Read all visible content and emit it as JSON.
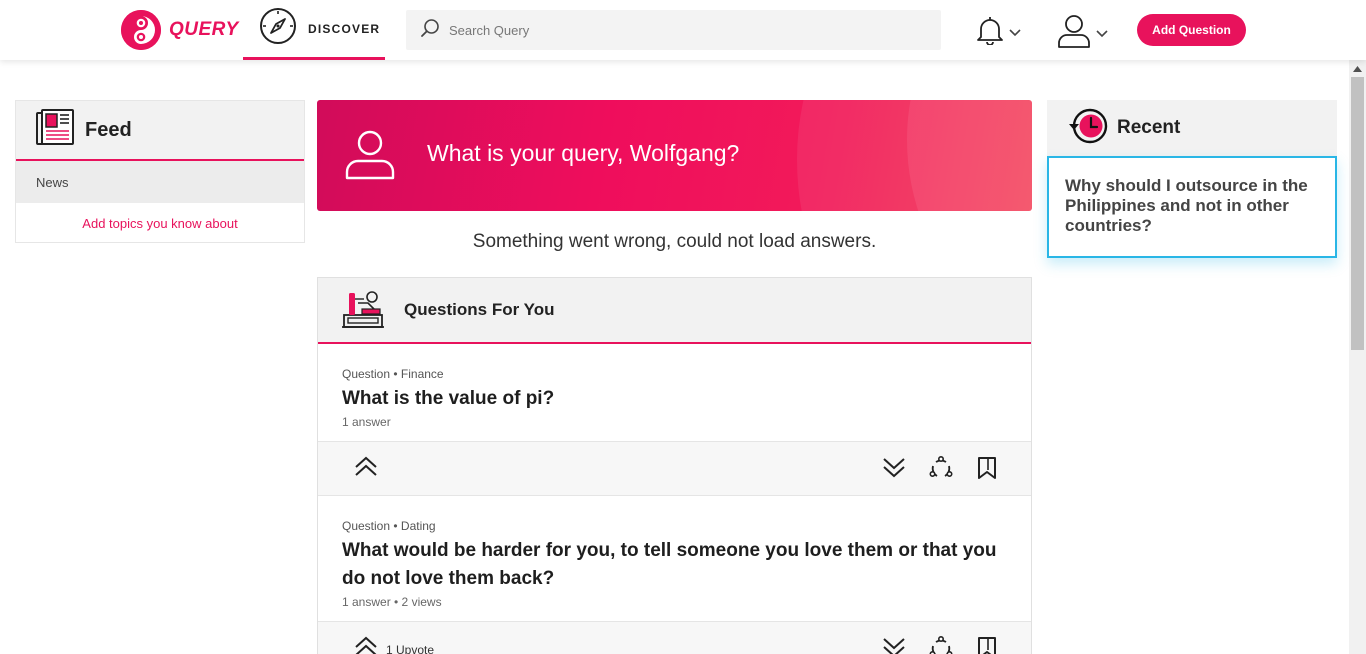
{
  "brand": {
    "name": "QUERY",
    "color": "#e8125c"
  },
  "nav": {
    "discover_label": "DISCOVER"
  },
  "search": {
    "placeholder": "Search Query"
  },
  "header": {
    "add_question_label": "Add Question"
  },
  "icons": {
    "logo": "query-logo-icon",
    "discover": "compass-icon",
    "search": "search-icon",
    "notifications": "bell-icon",
    "account": "user-icon",
    "dropdown": "chevron-down-icon",
    "feed": "newspaper-icon",
    "recent": "history-clock-icon",
    "questions": "desk-icon",
    "upvote": "double-chevron-up-icon",
    "downvote": "double-chevron-down-icon",
    "share": "share-icon",
    "bookmark": "bookmark-icon"
  },
  "feed": {
    "title": "Feed",
    "items": [
      {
        "label": "News"
      }
    ],
    "add_topics_label": "Add topics you know about"
  },
  "hero": {
    "prompt": "What is your query, Wolfgang?"
  },
  "error_message": "Something went wrong, could not load answers.",
  "questions_panel": {
    "title": "Questions For You",
    "questions": [
      {
        "meta": "Question • Finance",
        "title": "What is the value of pi?",
        "stats": "1 answer",
        "upvote_label": ""
      },
      {
        "meta": "Question • Dating",
        "title": "What would be harder for you, to tell someone you love them or that you do not love them back?",
        "stats": "1 answer • 2 views",
        "upvote_label": "1 Upvote"
      }
    ]
  },
  "recent": {
    "title": "Recent",
    "items": [
      {
        "question": "Why should I outsource in the Philippines and not in other countries?"
      }
    ]
  }
}
